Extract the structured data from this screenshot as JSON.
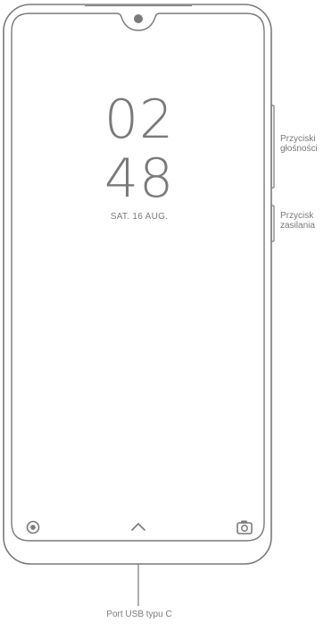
{
  "lock_screen": {
    "hour": "02",
    "minute": "48",
    "date": "SAT. 16 AUG."
  },
  "callouts": {
    "volume_buttons": "Przyciski głośności",
    "power_button": "Przycisk zasilania",
    "usb_port": "Port USB typu C"
  },
  "icons": {
    "bottom_left": "record-icon",
    "bottom_center": "chevron-up-icon",
    "bottom_right": "camera-icon",
    "top_center": "front-camera-icon"
  },
  "colors": {
    "line": "#7a7a7a",
    "text": "#7a7a7a"
  }
}
